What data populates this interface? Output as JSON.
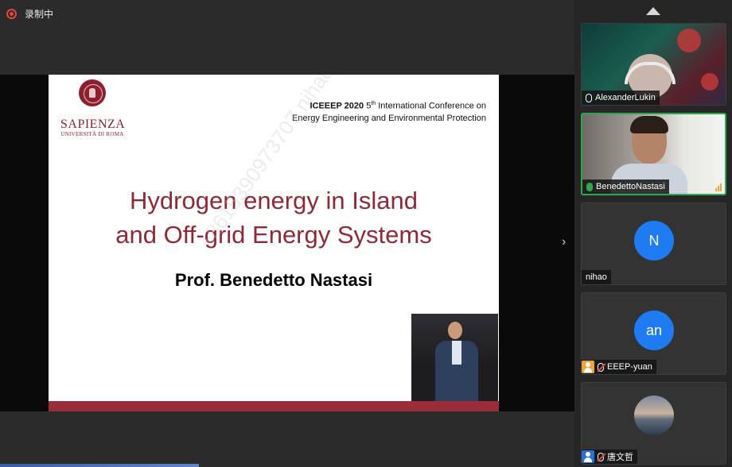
{
  "recording": {
    "label": "录制中",
    "color": "#e0463a"
  },
  "slide": {
    "university": {
      "name": "SAPIENZA",
      "sub": "UNIVERSITÀ DI ROMA",
      "color": "#8e1f2c"
    },
    "conference": {
      "short": "ICEEEP 2020",
      "ordinal": "5",
      "ordinal_suffix": "th",
      "line1_rest": "International Conference on",
      "line2": "Energy Engineering and Environmental Protection"
    },
    "title_line1": "Hydrogen energy in Island",
    "title_line2": "and Off-grid Energy Systems",
    "presenter": "Prof. Benedetto Nastasi",
    "watermark": "+8615390973707 nihao",
    "accent": "#9b2d3a"
  },
  "navigation": {
    "next_icon": "chevron-right-icon",
    "scroll_up_icon": "chevron-up-icon"
  },
  "participants": [
    {
      "name": "AlexanderLukin",
      "mic": "on",
      "video": true
    },
    {
      "name": "BenedettoNastasi",
      "mic": "speaking",
      "video": true,
      "active": true
    },
    {
      "name": "nihao",
      "avatar_text": "N",
      "mic": "none",
      "video": false
    },
    {
      "name": "EEEP-yuan",
      "avatar_text": "an",
      "mic": "muted",
      "video": false
    },
    {
      "name": "唐文哲",
      "mic": "muted",
      "video": false
    }
  ],
  "colors": {
    "avatar_blue": "#1e7bf2",
    "active_border": "#2fa84f"
  }
}
